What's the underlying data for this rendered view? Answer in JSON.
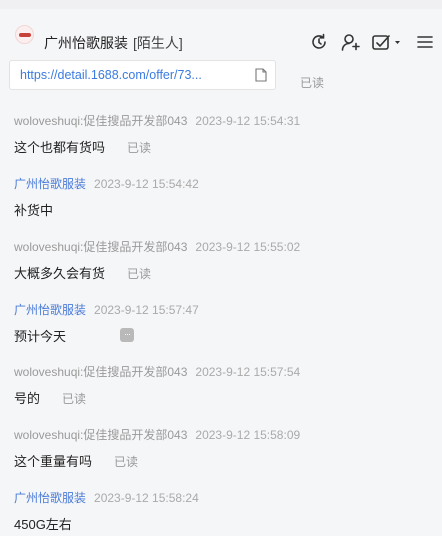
{
  "header": {
    "title": "广州怡歌服装",
    "tag": "[陌生人]",
    "icons": [
      "refresh-icon",
      "user-icon",
      "task-check-icon",
      "menu-icon"
    ]
  },
  "link_card": {
    "url": "https://detail.1688.com/offer/73...",
    "status": "已读"
  },
  "messages": [
    {
      "sender": "woloveshuqi:促佳搜品开发部043",
      "time": "2023-9-12 15:54:31",
      "text": "这个也都有货吗",
      "status": "已读"
    },
    {
      "sender": "广州怡歌服装",
      "time": "2023-9-12 15:54:42",
      "text": "补货中",
      "status": ""
    },
    {
      "sender": "woloveshuqi:促佳搜品开发部043",
      "time": "2023-9-12 15:55:02",
      "text": "大概多久会有货",
      "status": "已读"
    },
    {
      "sender": "广州怡歌服装",
      "time": "2023-9-12 15:57:47",
      "text": "预计今天",
      "status": ""
    },
    {
      "sender": "woloveshuqi:促佳搜品开发部043",
      "time": "2023-9-12 15:57:54",
      "text": "号的",
      "status": "已读"
    },
    {
      "sender": "woloveshuqi:促佳搜品开发部043",
      "time": "2023-9-12 15:58:09",
      "text": "这个重量有吗",
      "status": "已读"
    },
    {
      "sender": "广州怡歌服装",
      "time": "2023-9-12 15:58:24",
      "text": "450G左右",
      "status": ""
    }
  ],
  "badge": "···",
  "colors": {
    "self_sender": "#4a7bd8",
    "other_sender": "#9a9a9a",
    "link": "#3b7be0"
  }
}
